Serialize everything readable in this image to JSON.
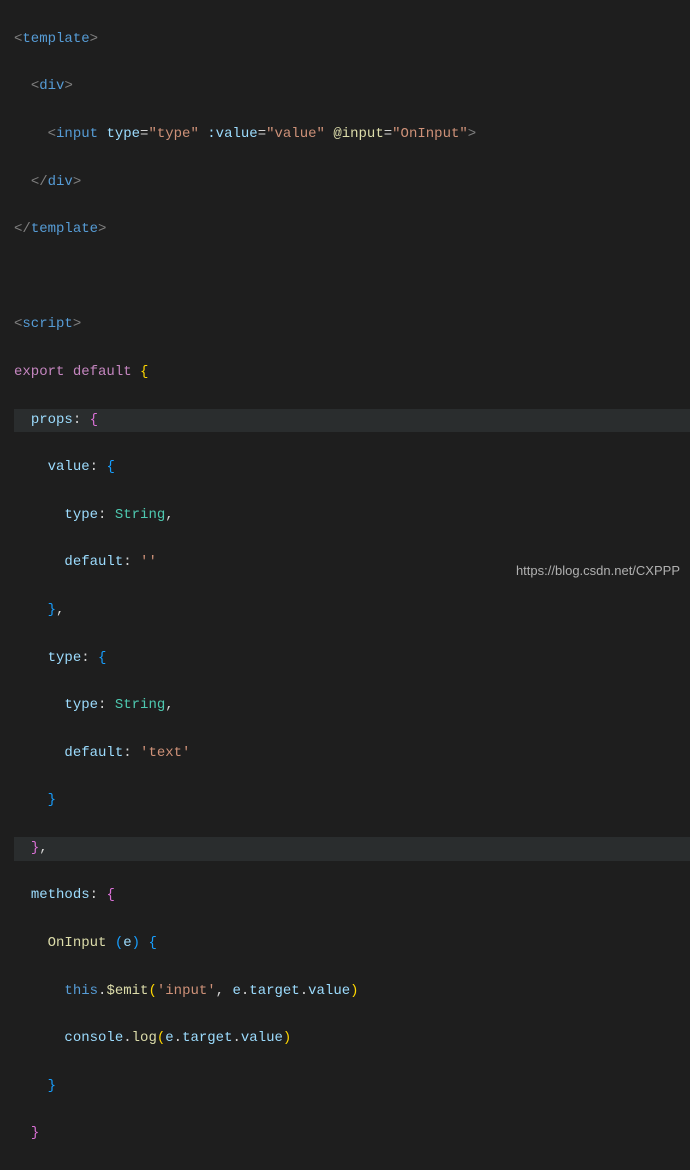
{
  "code": {
    "l1": {
      "tag_open": "<",
      "tag": "template",
      "tag_close": ">"
    },
    "l2": {
      "lt": "<",
      "tag": "div",
      "gt": ">"
    },
    "l3": {
      "lt": "<",
      "tag": "input",
      "sp": " ",
      "a1": "type",
      "eq": "=",
      "v1": "\"type\"",
      "a2": ":value",
      "v2": "\"value\"",
      "a3": "@input",
      "v3": "\"OnInput\"",
      "gt": ">"
    },
    "l4": {
      "lt": "</",
      "tag": "div",
      "gt": ">"
    },
    "l5": {
      "lt": "</",
      "tag": "template",
      "gt": ">"
    },
    "l6": "",
    "l7": {
      "lt": "<",
      "tag": "script",
      "gt": ">"
    },
    "l8": {
      "kw1": "export",
      "kw2": "default",
      "br": "{"
    },
    "l9": {
      "prop": "props",
      "colon": ":",
      "br": "{"
    },
    "l10": {
      "prop": "value",
      "colon": ":",
      "br": "{"
    },
    "l11": {
      "prop": "type",
      "colon": ":",
      "type": "String",
      "comma": ","
    },
    "l12": {
      "prop": "default",
      "colon": ":",
      "val": "''"
    },
    "l13": {
      "br": "}",
      "comma": ","
    },
    "l14": {
      "prop": "type",
      "colon": ":",
      "br": "{"
    },
    "l15": {
      "prop": "type",
      "colon": ":",
      "type": "String",
      "comma": ","
    },
    "l16": {
      "prop": "default",
      "colon": ":",
      "val": "'text'"
    },
    "l17": {
      "br": "}"
    },
    "l18": {
      "br": "}",
      "comma": ","
    },
    "l19": {
      "prop": "methods",
      "colon": ":",
      "br": "{"
    },
    "l20": {
      "fn": "OnInput",
      "sp": " ",
      "lp": "(",
      "arg": "e",
      "rp": ")",
      "br": "{"
    },
    "l21": {
      "this": "this",
      "dot": ".",
      "fn": "$emit",
      "lp": "(",
      "s1": "'input'",
      "comma": ",",
      "sp": " ",
      "arg": "e",
      "dot2": ".",
      "p1": "target",
      "dot3": ".",
      "p2": "value",
      "rp": ")"
    },
    "l22": {
      "obj": "console",
      "dot": ".",
      "fn": "log",
      "lp": "(",
      "arg": "e",
      "dot2": ".",
      "p1": "target",
      "dot3": ".",
      "p2": "value",
      "rp": ")"
    },
    "l23": {
      "br": "}"
    },
    "l24": {
      "br": "}"
    }
  },
  "watermark": "https://blog.csdn.net/CXPPP"
}
